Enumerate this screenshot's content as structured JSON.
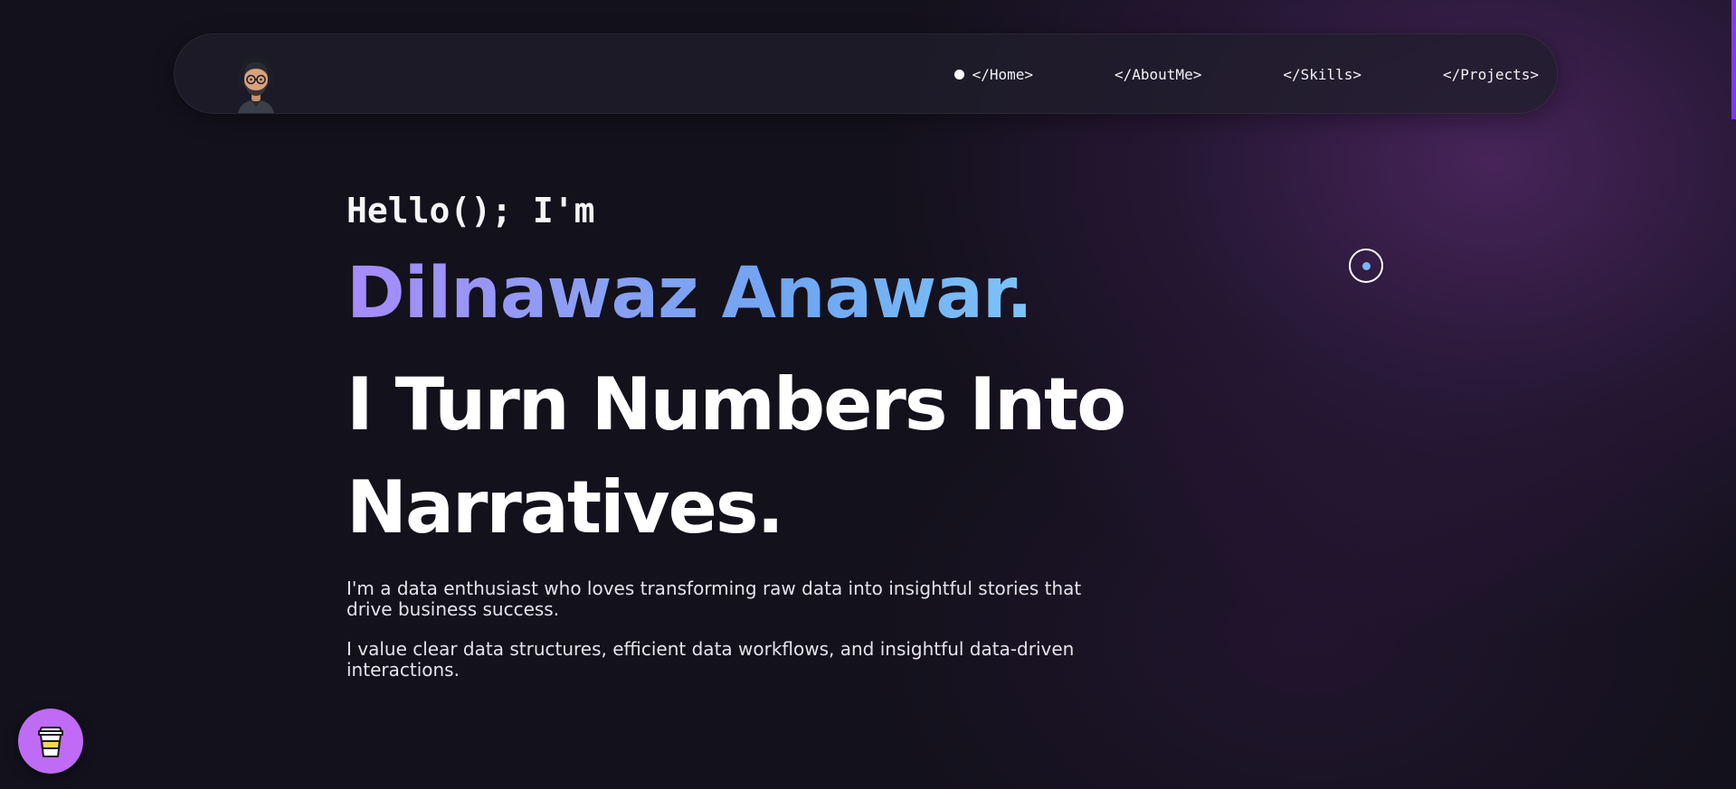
{
  "nav": {
    "avatar_icon": "avatar-memoji-with-headphones",
    "active_index": 0,
    "links": [
      {
        "label": "</Home>"
      },
      {
        "label": "</AboutMe>"
      },
      {
        "label": "</Skills>"
      },
      {
        "label": "</Projects>"
      }
    ]
  },
  "hero": {
    "greeting": "Hello(); I'm",
    "name": "Dilnawaz Anawar.",
    "headline": "I Turn Numbers Into Narratives.",
    "intro_1": "I'm a data enthusiast who loves transforming raw data into insightful stories that drive business success.",
    "intro_2": "I value clear data structures, efficient data workflows, and insightful data-driven interactions."
  },
  "floating": {
    "coffee_icon": "coffee-cup-icon",
    "cursor_icon": "cursor-ring-icon"
  },
  "colors": {
    "background": "#13111c",
    "accent_purple": "#c06bf5",
    "name_gradient_start": "#a78bfa",
    "name_gradient_end": "#7cc4f8",
    "cursor_dot": "#7ab8f5",
    "scroll_indicator": "#8b3fd9"
  }
}
